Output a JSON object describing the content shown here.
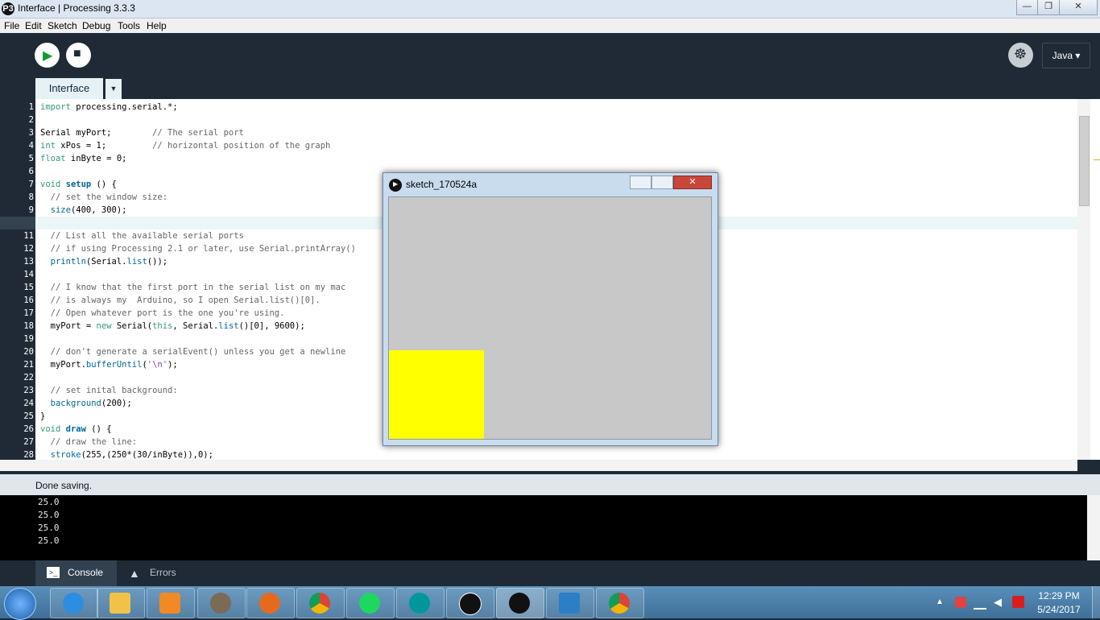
{
  "window": {
    "title": "Interface | Processing 3.3.3",
    "app_icon_glyph": "P3",
    "min_glyph": "—",
    "max_glyph": "❐",
    "close_glyph": "✕"
  },
  "menu": [
    "File",
    "Edit",
    "Sketch",
    "Debug",
    "Tools",
    "Help"
  ],
  "toolbar": {
    "run_glyph": "▶",
    "stop_glyph": "■",
    "debug_glyph": "☸",
    "mode_label": "Java ▾"
  },
  "tabs": {
    "active": "Interface",
    "dropdown_glyph": "▼"
  },
  "editor": {
    "line_numbers": [
      "1",
      "2",
      "3",
      "4",
      "5",
      "6",
      "7",
      "8",
      "9",
      "10",
      "11",
      "12",
      "13",
      "14",
      "15",
      "16",
      "17",
      "18",
      "19",
      "20",
      "21",
      "22",
      "23",
      "24",
      "25",
      "26",
      "27",
      "28"
    ],
    "lines": [
      "import processing.serial.*;",
      "",
      "Serial myPort;        // The serial port",
      "int xPos = 1;         // horizontal position of the graph",
      "float inByte = 0;",
      "",
      "void setup () {",
      "  // set the window size:",
      "  size(400, 300);",
      "",
      "  // List all the available serial ports",
      "  // if using Processing 2.1 or later, use Serial.printArray()",
      "  println(Serial.list());",
      "",
      "  // I know that the first port in the serial list on my mac",
      "  // is always my  Arduino, so I open Serial.list()[0].",
      "  // Open whatever port is the one you're using.",
      "  myPort = new Serial(this, Serial.list()[0], 9600);",
      "",
      "  // don't generate a serialEvent() unless you get a newline",
      "  myPort.bufferUntil('\\n');",
      "",
      "  // set inital background:",
      "  background(200);",
      "}",
      "void draw () {",
      "  // draw the line:",
      "  stroke(255,(250*(30/inByte)),0);"
    ]
  },
  "status": {
    "message": "Done saving."
  },
  "console": {
    "lines": [
      "25.0",
      "25.0",
      "25.0",
      "25.0"
    ]
  },
  "bottom_tabs": {
    "console_label": "Console",
    "errors_label": "Errors"
  },
  "sketch_window": {
    "title": "sketch_170524a",
    "canvas_color": "#c8c8c8",
    "rect_color": "#ffff00"
  },
  "taskbar": {
    "apps": [
      "start-orb",
      "internet-explorer",
      "file-explorer",
      "media-player",
      "gimp",
      "firefox",
      "chrome",
      "spotify",
      "arduino",
      "processing",
      "sketch-runner",
      "teamviewer",
      "chrome"
    ],
    "time": "12:29 PM",
    "date": "5/24/2017"
  },
  "colors": {
    "ide_dark": "#1f2a36",
    "tab_active": "#e6f1f5",
    "keyword": "#33997e",
    "function": "#006699",
    "comment": "#666666"
  }
}
